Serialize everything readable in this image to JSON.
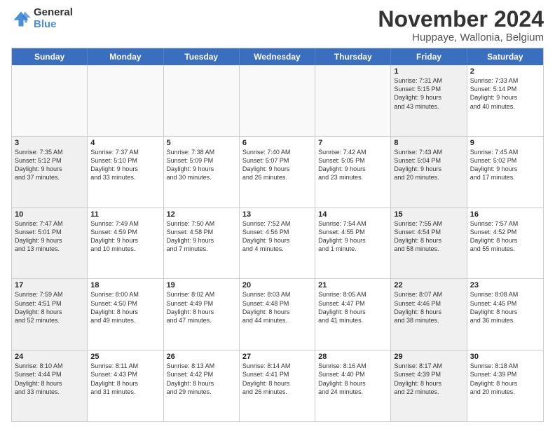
{
  "logo": {
    "line1": "General",
    "line2": "Blue"
  },
  "title": "November 2024",
  "subtitle": "Huppaye, Wallonia, Belgium",
  "weekdays": [
    "Sunday",
    "Monday",
    "Tuesday",
    "Wednesday",
    "Thursday",
    "Friday",
    "Saturday"
  ],
  "weeks": [
    [
      {
        "day": "",
        "info": "",
        "empty": true
      },
      {
        "day": "",
        "info": "",
        "empty": true
      },
      {
        "day": "",
        "info": "",
        "empty": true
      },
      {
        "day": "",
        "info": "",
        "empty": true
      },
      {
        "day": "",
        "info": "",
        "empty": true
      },
      {
        "day": "1",
        "info": "Sunrise: 7:31 AM\nSunset: 5:15 PM\nDaylight: 9 hours\nand 43 minutes.",
        "shaded": true
      },
      {
        "day": "2",
        "info": "Sunrise: 7:33 AM\nSunset: 5:14 PM\nDaylight: 9 hours\nand 40 minutes."
      }
    ],
    [
      {
        "day": "3",
        "info": "Sunrise: 7:35 AM\nSunset: 5:12 PM\nDaylight: 9 hours\nand 37 minutes.",
        "shaded": true
      },
      {
        "day": "4",
        "info": "Sunrise: 7:37 AM\nSunset: 5:10 PM\nDaylight: 9 hours\nand 33 minutes."
      },
      {
        "day": "5",
        "info": "Sunrise: 7:38 AM\nSunset: 5:09 PM\nDaylight: 9 hours\nand 30 minutes."
      },
      {
        "day": "6",
        "info": "Sunrise: 7:40 AM\nSunset: 5:07 PM\nDaylight: 9 hours\nand 26 minutes."
      },
      {
        "day": "7",
        "info": "Sunrise: 7:42 AM\nSunset: 5:05 PM\nDaylight: 9 hours\nand 23 minutes."
      },
      {
        "day": "8",
        "info": "Sunrise: 7:43 AM\nSunset: 5:04 PM\nDaylight: 9 hours\nand 20 minutes.",
        "shaded": true
      },
      {
        "day": "9",
        "info": "Sunrise: 7:45 AM\nSunset: 5:02 PM\nDaylight: 9 hours\nand 17 minutes."
      }
    ],
    [
      {
        "day": "10",
        "info": "Sunrise: 7:47 AM\nSunset: 5:01 PM\nDaylight: 9 hours\nand 13 minutes.",
        "shaded": true
      },
      {
        "day": "11",
        "info": "Sunrise: 7:49 AM\nSunset: 4:59 PM\nDaylight: 9 hours\nand 10 minutes."
      },
      {
        "day": "12",
        "info": "Sunrise: 7:50 AM\nSunset: 4:58 PM\nDaylight: 9 hours\nand 7 minutes."
      },
      {
        "day": "13",
        "info": "Sunrise: 7:52 AM\nSunset: 4:56 PM\nDaylight: 9 hours\nand 4 minutes."
      },
      {
        "day": "14",
        "info": "Sunrise: 7:54 AM\nSunset: 4:55 PM\nDaylight: 9 hours\nand 1 minute."
      },
      {
        "day": "15",
        "info": "Sunrise: 7:55 AM\nSunset: 4:54 PM\nDaylight: 8 hours\nand 58 minutes.",
        "shaded": true
      },
      {
        "day": "16",
        "info": "Sunrise: 7:57 AM\nSunset: 4:52 PM\nDaylight: 8 hours\nand 55 minutes."
      }
    ],
    [
      {
        "day": "17",
        "info": "Sunrise: 7:59 AM\nSunset: 4:51 PM\nDaylight: 8 hours\nand 52 minutes.",
        "shaded": true
      },
      {
        "day": "18",
        "info": "Sunrise: 8:00 AM\nSunset: 4:50 PM\nDaylight: 8 hours\nand 49 minutes."
      },
      {
        "day": "19",
        "info": "Sunrise: 8:02 AM\nSunset: 4:49 PM\nDaylight: 8 hours\nand 47 minutes."
      },
      {
        "day": "20",
        "info": "Sunrise: 8:03 AM\nSunset: 4:48 PM\nDaylight: 8 hours\nand 44 minutes."
      },
      {
        "day": "21",
        "info": "Sunrise: 8:05 AM\nSunset: 4:47 PM\nDaylight: 8 hours\nand 41 minutes."
      },
      {
        "day": "22",
        "info": "Sunrise: 8:07 AM\nSunset: 4:46 PM\nDaylight: 8 hours\nand 38 minutes.",
        "shaded": true
      },
      {
        "day": "23",
        "info": "Sunrise: 8:08 AM\nSunset: 4:45 PM\nDaylight: 8 hours\nand 36 minutes."
      }
    ],
    [
      {
        "day": "24",
        "info": "Sunrise: 8:10 AM\nSunset: 4:44 PM\nDaylight: 8 hours\nand 33 minutes.",
        "shaded": true
      },
      {
        "day": "25",
        "info": "Sunrise: 8:11 AM\nSunset: 4:43 PM\nDaylight: 8 hours\nand 31 minutes."
      },
      {
        "day": "26",
        "info": "Sunrise: 8:13 AM\nSunset: 4:42 PM\nDaylight: 8 hours\nand 29 minutes."
      },
      {
        "day": "27",
        "info": "Sunrise: 8:14 AM\nSunset: 4:41 PM\nDaylight: 8 hours\nand 26 minutes."
      },
      {
        "day": "28",
        "info": "Sunrise: 8:16 AM\nSunset: 4:40 PM\nDaylight: 8 hours\nand 24 minutes."
      },
      {
        "day": "29",
        "info": "Sunrise: 8:17 AM\nSunset: 4:39 PM\nDaylight: 8 hours\nand 22 minutes.",
        "shaded": true
      },
      {
        "day": "30",
        "info": "Sunrise: 8:18 AM\nSunset: 4:39 PM\nDaylight: 8 hours\nand 20 minutes."
      }
    ]
  ]
}
